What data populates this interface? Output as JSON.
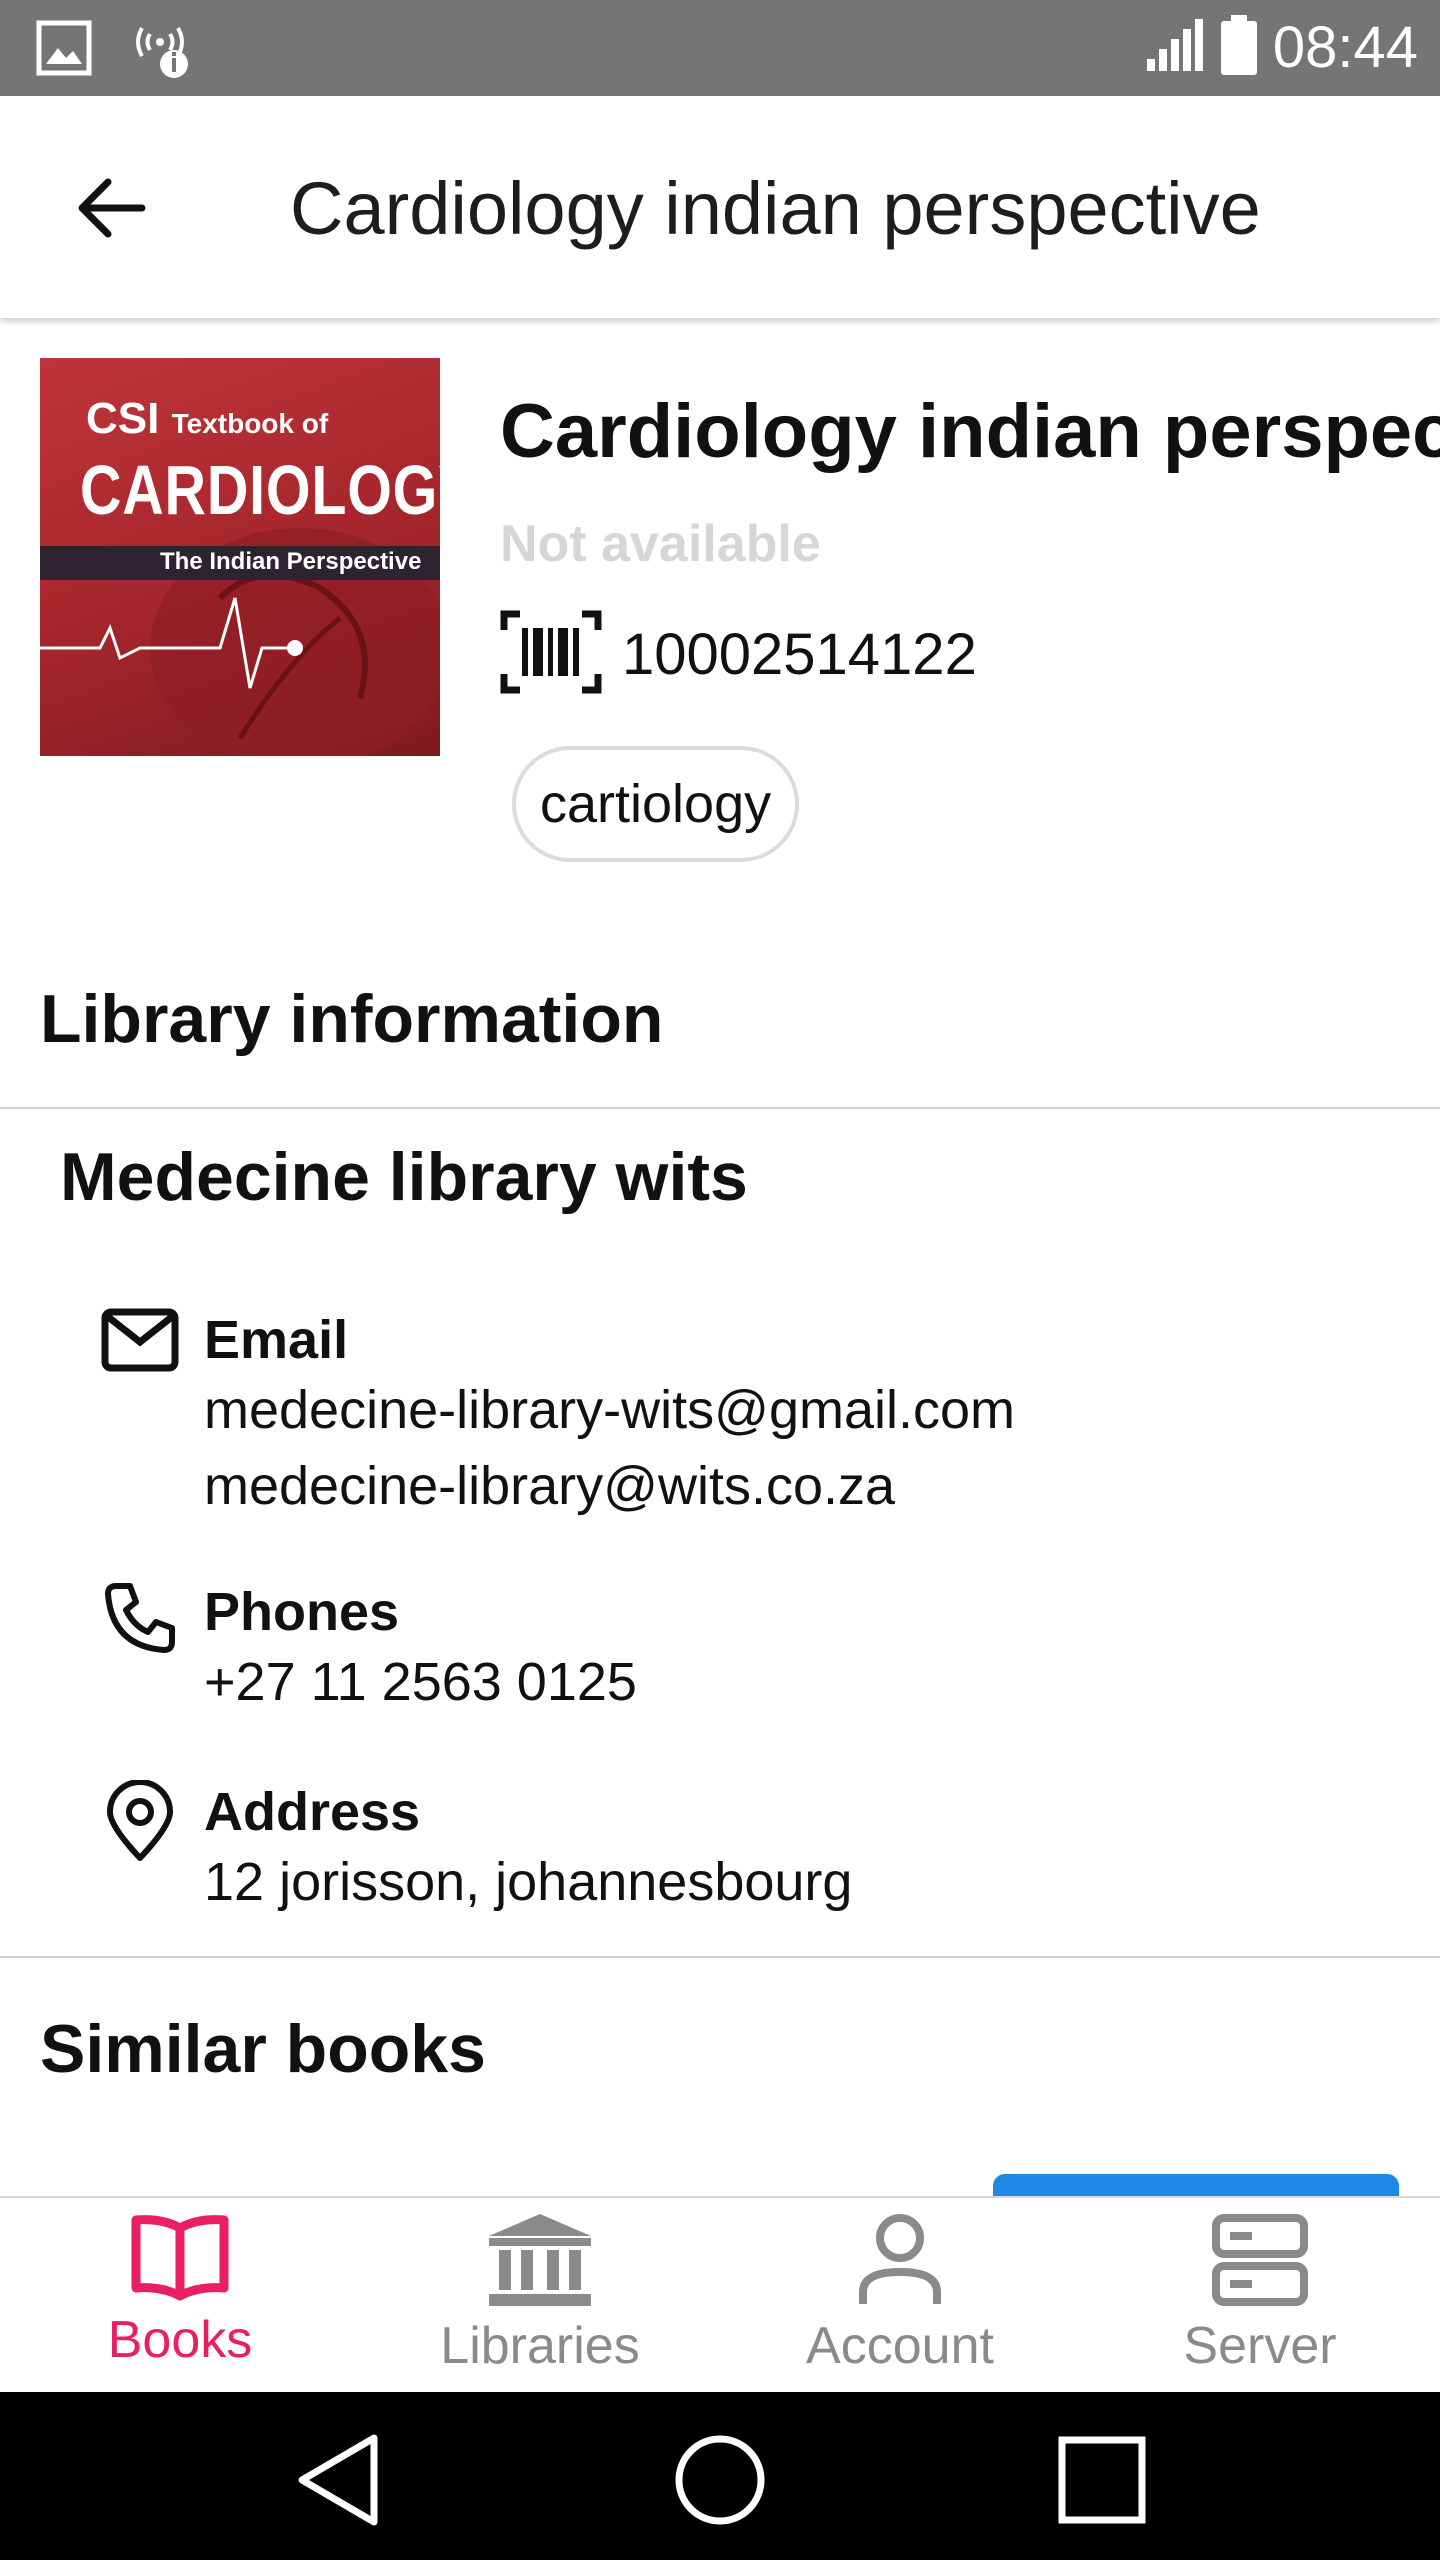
{
  "status_bar": {
    "time": "08:44"
  },
  "app_bar": {
    "title": "Cardiology indian perspective"
  },
  "book": {
    "cover": {
      "line1_big": "CSI",
      "line1_small": "Textbook of",
      "line2": "CARDIOLOGY",
      "line3": "The Indian Perspective"
    },
    "title": "Cardiology indian perspective",
    "availability": "Not available",
    "barcode": "10002514122",
    "tag": "cartiology"
  },
  "library_section": {
    "heading": "Library information",
    "name": "Medecine library wits",
    "email": {
      "label": "Email",
      "values": [
        "medecine-library-wits@gmail.com",
        "medecine-library@wits.co.za"
      ]
    },
    "phones": {
      "label": "Phones",
      "values": [
        "+27 11 2563 0125"
      ]
    },
    "address": {
      "label": "Address",
      "values": [
        "12 jorisson, johannesbourg"
      ]
    }
  },
  "similar_section": {
    "heading": "Similar books"
  },
  "bottom_nav": {
    "items": [
      {
        "label": "Books",
        "icon": "book-icon",
        "active": true
      },
      {
        "label": "Libraries",
        "icon": "library-icon",
        "active": false
      },
      {
        "label": "Account",
        "icon": "account-icon",
        "active": false
      },
      {
        "label": "Server",
        "icon": "server-icon",
        "active": false
      }
    ]
  },
  "colors": {
    "accent": "#e91e63",
    "inactive": "#8a8a8a",
    "status_bar": "#757575",
    "button_blue": "#1e88e5"
  }
}
